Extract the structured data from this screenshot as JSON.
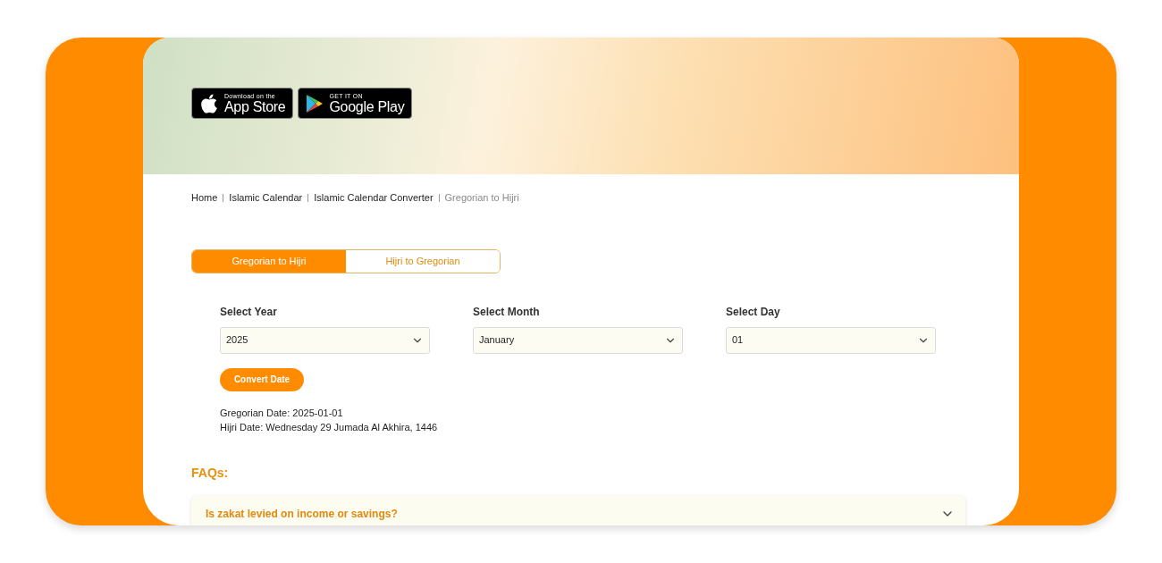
{
  "store_badges": [
    {
      "kind": "apple",
      "small": "Download on the",
      "large": "App Store"
    },
    {
      "kind": "google",
      "small": "GET IT ON",
      "large": "Google Play"
    }
  ],
  "breadcrumb": [
    {
      "label": "Home",
      "current": false
    },
    {
      "label": "Islamic Calendar",
      "current": false
    },
    {
      "label": "Islamic Calendar Converter",
      "current": false
    },
    {
      "label": "Gregorian to Hijri",
      "current": true
    }
  ],
  "tabs": [
    {
      "label": "Gregorian to Hijri",
      "selected": true
    },
    {
      "label": "Hijri to Gregorian",
      "selected": false
    }
  ],
  "selects": [
    {
      "label": "Select Year",
      "value": "2025"
    },
    {
      "label": "Select Month",
      "value": "January"
    },
    {
      "label": "Select Day",
      "value": "01"
    }
  ],
  "convert_button": "Convert Date",
  "results": [
    "Gregorian Date: 2025-01-01",
    "Hijri Date: Wednesday 29 Jumada Al Akhira, 1446"
  ],
  "faq_title": "FAQs:",
  "faqs": [
    {
      "question": "Is zakat levied on income or savings?",
      "expanded": false
    }
  ]
}
